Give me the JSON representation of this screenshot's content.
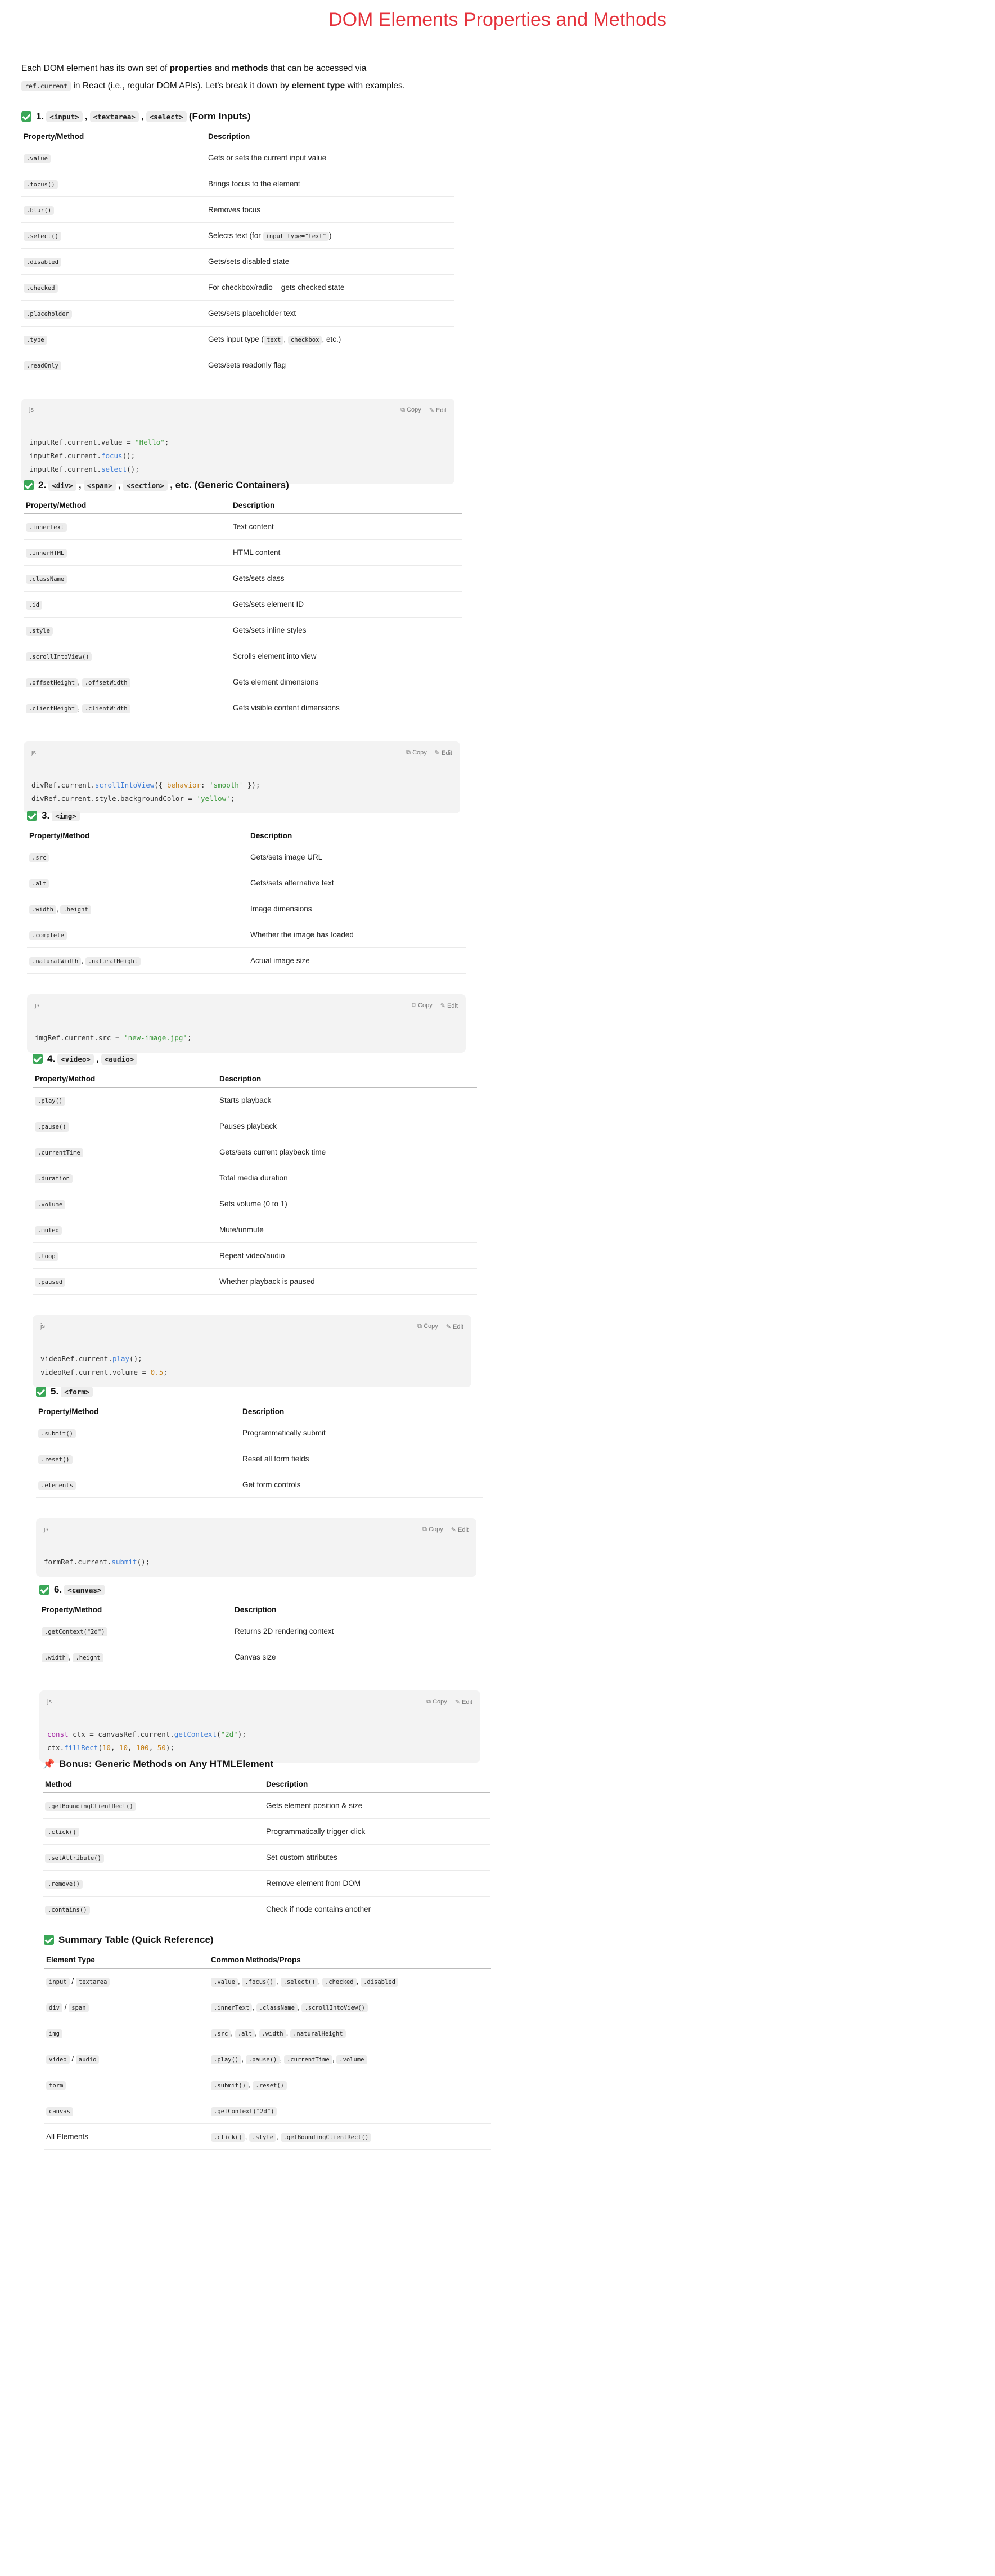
{
  "title": "DOM Elements Properties and Methods",
  "intro": {
    "p1": "Each DOM element has its own set of ",
    "b1": "properties",
    "p2": " and ",
    "b2": "methods",
    "p3": " that can be accessed via",
    "code": "ref.current",
    "p4": " in React (i.e., regular DOM APIs). Let's break it down by ",
    "b3": "element type",
    "p5": " with examples."
  },
  "code_ui": {
    "lang": "js",
    "copy": "Copy",
    "edit": "Edit"
  },
  "headers": {
    "prop_method": "Property/Method",
    "method": "Method",
    "description": "Description",
    "element_type": "Element Type",
    "common": "Common Methods/Props"
  },
  "s1": {
    "num": "1.",
    "tags": [
      "<input>",
      "<textarea>",
      "<select>"
    ],
    "suffix": "(Form Inputs)",
    "rows": [
      {
        "p": ".value",
        "d": "Gets or sets the current input value"
      },
      {
        "p": ".focus()",
        "d": "Brings focus to the element"
      },
      {
        "p": ".blur()",
        "d": "Removes focus"
      },
      {
        "p": ".select()",
        "d_pre": "Selects text (for ",
        "d_code": "input type=\"text\"",
        "d_post": ")"
      },
      {
        "p": ".disabled",
        "d": "Gets/sets disabled state"
      },
      {
        "p": ".checked",
        "d": "For checkbox/radio – gets checked state"
      },
      {
        "p": ".placeholder",
        "d": "Gets/sets placeholder text"
      },
      {
        "p": ".type",
        "d_pre": "Gets input type (",
        "d_code": "text",
        "d_mid": ", ",
        "d_code2": "checkbox",
        "d_post": ", etc.)"
      },
      {
        "p": ".readOnly",
        "d": "Gets/sets readonly flag"
      }
    ],
    "code": [
      "inputRef.current.value = ",
      "\"Hello\"",
      ";",
      "inputRef.current.",
      "focus",
      "();",
      "inputRef.current.",
      "select",
      "();"
    ]
  },
  "s2": {
    "num": "2.",
    "tags": [
      "<div>",
      "<span>",
      "<section>"
    ],
    "suffix": ", etc. (Generic Containers)",
    "rows": [
      {
        "p": ".innerText",
        "d": "Text content"
      },
      {
        "p": ".innerHTML",
        "d": "HTML content"
      },
      {
        "p": ".className",
        "d": "Gets/sets class"
      },
      {
        "p": ".id",
        "d": "Gets/sets element ID"
      },
      {
        "p": ".style",
        "d": "Gets/sets inline styles"
      },
      {
        "p": ".scrollIntoView()",
        "d": "Scrolls element into view"
      },
      {
        "p": ".offsetHeight",
        "p2": ".offsetWidth",
        "d": "Gets element dimensions"
      },
      {
        "p": ".clientHeight",
        "p2": ".clientWidth",
        "d": "Gets visible content dimensions"
      }
    ]
  },
  "s3": {
    "num": "3.",
    "tags": [
      "<img>"
    ],
    "suffix": "",
    "rows": [
      {
        "p": ".src",
        "d": "Gets/sets image URL"
      },
      {
        "p": ".alt",
        "d": "Gets/sets alternative text"
      },
      {
        "p": ".width",
        "p2": ".height",
        "d": "Image dimensions"
      },
      {
        "p": ".complete",
        "d": "Whether the image has loaded"
      },
      {
        "p": ".naturalWidth",
        "p2": ".naturalHeight",
        "d": "Actual image size"
      }
    ]
  },
  "s4": {
    "num": "4.",
    "tags": [
      "<video>",
      "<audio>"
    ],
    "suffix": "",
    "rows": [
      {
        "p": ".play()",
        "d": "Starts playback"
      },
      {
        "p": ".pause()",
        "d": "Pauses playback"
      },
      {
        "p": ".currentTime",
        "d": "Gets/sets current playback time"
      },
      {
        "p": ".duration",
        "d": "Total media duration"
      },
      {
        "p": ".volume",
        "d": "Sets volume (0 to 1)"
      },
      {
        "p": ".muted",
        "d": "Mute/unmute"
      },
      {
        "p": ".loop",
        "d": "Repeat video/audio"
      },
      {
        "p": ".paused",
        "d": "Whether playback is paused"
      }
    ]
  },
  "s5": {
    "num": "5.",
    "tags": [
      "<form>"
    ],
    "suffix": "",
    "rows": [
      {
        "p": ".submit()",
        "d": "Programmatically submit"
      },
      {
        "p": ".reset()",
        "d": "Reset all form fields"
      },
      {
        "p": ".elements",
        "d": "Get form controls"
      }
    ]
  },
  "s6": {
    "num": "6.",
    "tags": [
      "<canvas>"
    ],
    "suffix": "",
    "rows": [
      {
        "p": ".getContext(\"2d\")",
        "d": "Returns 2D rendering context"
      },
      {
        "p": ".width",
        "p2": ".height",
        "d": "Canvas size"
      }
    ]
  },
  "s7": {
    "title": "Bonus: Generic Methods on Any HTMLElement",
    "rows": [
      {
        "p": ".getBoundingClientRect()",
        "d": "Gets element position & size"
      },
      {
        "p": ".click()",
        "d": "Programmatically trigger click"
      },
      {
        "p": ".setAttribute()",
        "d": "Set custom attributes"
      },
      {
        "p": ".remove()",
        "d": "Remove element from DOM"
      },
      {
        "p": ".contains()",
        "d": "Check if node contains another"
      }
    ]
  },
  "s8": {
    "title": "Summary Table (Quick Reference)",
    "rows": [
      {
        "t": [
          "input",
          "textarea"
        ],
        "c": [
          ".value",
          ".focus()",
          ".select()",
          ".checked",
          ".disabled"
        ]
      },
      {
        "t": [
          "div",
          "span"
        ],
        "c": [
          ".innerText",
          ".className",
          ".scrollIntoView()"
        ]
      },
      {
        "t": [
          "img"
        ],
        "c": [
          ".src",
          ".alt",
          ".width",
          ".naturalHeight"
        ]
      },
      {
        "t": [
          "video",
          "audio"
        ],
        "c": [
          ".play()",
          ".pause()",
          ".currentTime",
          ".volume"
        ]
      },
      {
        "t": [
          "form"
        ],
        "c": [
          ".submit()",
          ".reset()"
        ]
      },
      {
        "t": [
          "canvas"
        ],
        "c": [
          ".getContext(\"2d\")"
        ]
      },
      {
        "tplain": "All Elements",
        "c": [
          ".click()",
          ".style",
          ".getBoundingClientRect()"
        ]
      }
    ]
  },
  "codes": {
    "c1": [
      [
        [
          "",
          "inputRef.current.value = "
        ],
        [
          "str",
          "\"Hello\""
        ],
        [
          "",
          ";"
        ]
      ],
      [
        [
          "",
          "inputRef.current."
        ],
        [
          "fn",
          "focus"
        ],
        [
          "",
          "();"
        ]
      ],
      [
        [
          "",
          "inputRef.current."
        ],
        [
          "fn",
          "select"
        ],
        [
          "",
          "();"
        ]
      ]
    ],
    "c2": [
      [
        [
          "",
          "divRef.current."
        ],
        [
          "fn",
          "scrollIntoView"
        ],
        [
          "",
          "({ "
        ],
        [
          "prop",
          "behavior"
        ],
        [
          "",
          ": "
        ],
        [
          "str",
          "'smooth'"
        ],
        [
          "",
          " });"
        ]
      ],
      [
        [
          "",
          "divRef.current.style.backgroundColor = "
        ],
        [
          "str",
          "'yellow'"
        ],
        [
          "",
          ";"
        ]
      ]
    ],
    "c3": [
      [
        [
          "",
          "imgRef.current.src = "
        ],
        [
          "str",
          "'new-image.jpg'"
        ],
        [
          "",
          ";"
        ]
      ]
    ],
    "c4": [
      [
        [
          "",
          "videoRef.current."
        ],
        [
          "fn",
          "play"
        ],
        [
          "",
          "();"
        ]
      ],
      [
        [
          "",
          "videoRef.current.volume = "
        ],
        [
          "num",
          "0.5"
        ],
        [
          "",
          ";"
        ]
      ]
    ],
    "c5": [
      [
        [
          "",
          "formRef.current."
        ],
        [
          "fn",
          "submit"
        ],
        [
          "",
          "();"
        ]
      ]
    ],
    "c6": [
      [
        [
          "kw",
          "const"
        ],
        [
          "",
          " ctx = canvasRef.current."
        ],
        [
          "fn",
          "getContext"
        ],
        [
          "",
          "("
        ],
        [
          "str",
          "\"2d\""
        ],
        [
          "",
          ");"
        ]
      ],
      [
        [
          "",
          "ctx."
        ],
        [
          "fn",
          "fillRect"
        ],
        [
          "",
          "("
        ],
        [
          "num",
          "10"
        ],
        [
          "",
          ", "
        ],
        [
          "num",
          "10"
        ],
        [
          "",
          ", "
        ],
        [
          "num",
          "100"
        ],
        [
          "",
          ", "
        ],
        [
          "num",
          "50"
        ],
        [
          "",
          ");"
        ]
      ]
    ]
  }
}
